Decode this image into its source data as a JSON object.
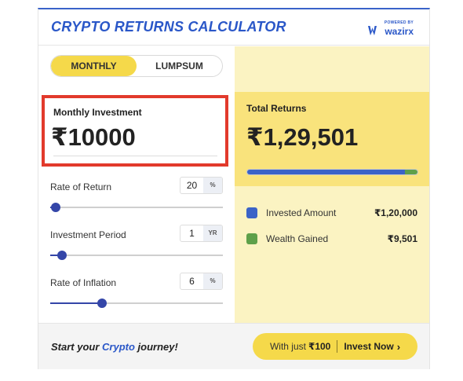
{
  "header": {
    "title": "CRYPTO RETURNS CALCULATOR",
    "brand_powered": "POWERED BY",
    "brand_name": "wazirx"
  },
  "toggle": {
    "options": [
      "MONTHLY",
      "LUMPSUM"
    ],
    "selected": "MONTHLY"
  },
  "investment": {
    "label": "Monthly Investment",
    "value": "₹10000"
  },
  "sliders": [
    {
      "label": "Rate of Return",
      "value": "20",
      "unit": "%",
      "level": 0.03
    },
    {
      "label": "Investment Period",
      "value": "1",
      "unit": "YR",
      "level": 0.07
    },
    {
      "label": "Rate of Inflation",
      "value": "6",
      "unit": "%",
      "level": 0.3
    }
  ],
  "results": {
    "total_label": "Total Returns",
    "total_value": "₹1,29,501",
    "invested_share": 0.927,
    "legend": [
      {
        "label": "Invested Amount",
        "value": "₹1,20,000",
        "color": "#3b63c7"
      },
      {
        "label": "Wealth Gained",
        "value": "₹9,501",
        "color": "#5ea04a"
      }
    ]
  },
  "footer": {
    "text_pre": "Start your ",
    "text_accent": "Crypto",
    "text_post": " journey!",
    "cta_pre": "With just",
    "cta_amount": "₹100",
    "cta_label": "Invest Now",
    "cta_icon": "chevron-right-icon"
  },
  "colors": {
    "accent": "#2a57c8",
    "highlight": "#e23a2c",
    "yellow": "#f5d94a",
    "slider": "#3446a8"
  }
}
